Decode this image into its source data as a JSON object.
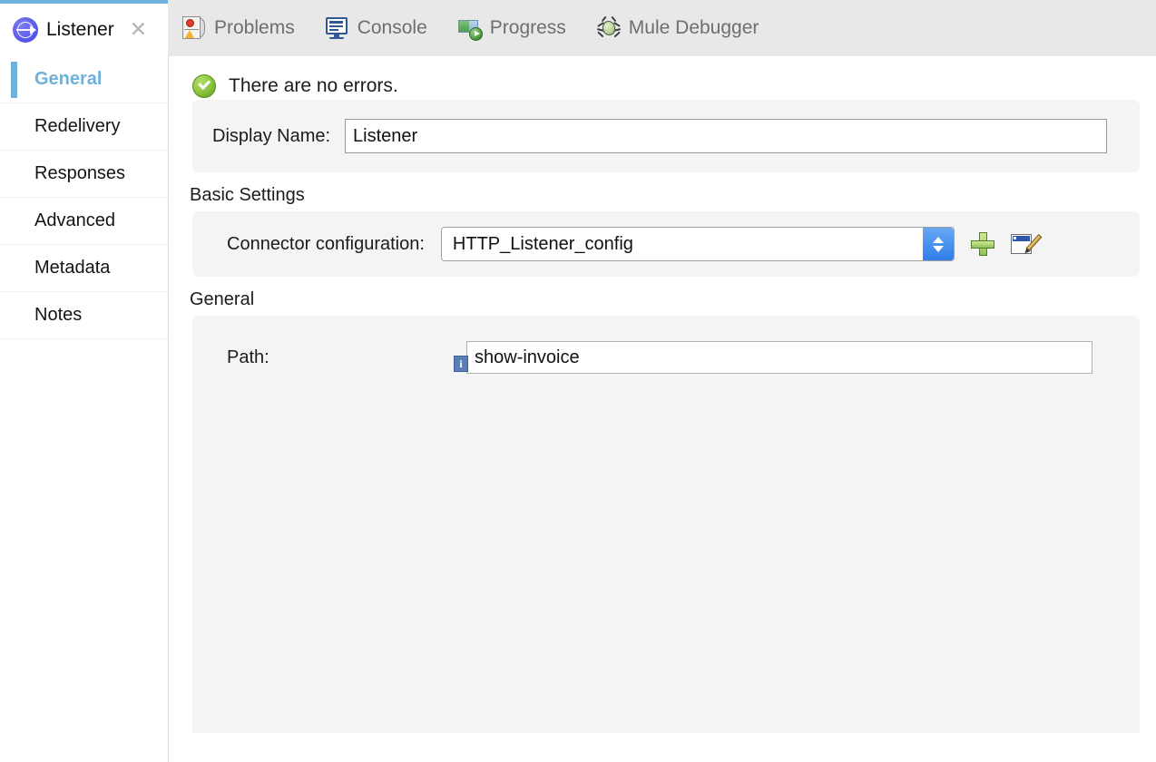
{
  "window": {
    "tabs": [
      {
        "label": "Listener",
        "icon": "listener-globe-icon",
        "active": true,
        "closable": true
      },
      {
        "label": "Problems",
        "icon": "problems-icon",
        "active": false,
        "closable": false
      },
      {
        "label": "Console",
        "icon": "console-icon",
        "active": false,
        "closable": false
      },
      {
        "label": "Progress",
        "icon": "progress-icon",
        "active": false,
        "closable": false
      },
      {
        "label": "Mule Debugger",
        "icon": "bug-icon",
        "active": false,
        "closable": false
      }
    ],
    "close_glyph": "✕"
  },
  "sidebar": {
    "items": [
      {
        "label": "General",
        "selected": true
      },
      {
        "label": "Redelivery",
        "selected": false
      },
      {
        "label": "Responses",
        "selected": false
      },
      {
        "label": "Advanced",
        "selected": false
      },
      {
        "label": "Metadata",
        "selected": false
      },
      {
        "label": "Notes",
        "selected": false
      }
    ]
  },
  "status": {
    "icon": "success-check-icon",
    "message": "There are no errors."
  },
  "form": {
    "display_name": {
      "label": "Display Name:",
      "value": "Listener"
    },
    "basic_settings": {
      "title": "Basic Settings",
      "connector_configuration": {
        "label": "Connector configuration:",
        "value": "HTTP_Listener_config",
        "add_button": "add-connector-config-button",
        "edit_button": "edit-connector-config-button"
      }
    },
    "general": {
      "title": "General",
      "path": {
        "label": "Path:",
        "value": "show-invoice",
        "info_glyph": "i"
      }
    }
  },
  "colors": {
    "accent": "#6eb0db",
    "tab_bar_bg": "#e8e8e8",
    "panel_bg": "#f4f4f4",
    "spinner_blue": "#2f7de8",
    "success_green": "#8cc63f"
  }
}
